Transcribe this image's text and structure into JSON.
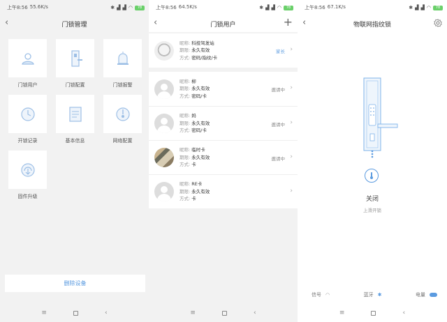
{
  "status": {
    "p1": {
      "time": "上午8:56",
      "speed": "55.6K/s",
      "battery": "78"
    },
    "p2": {
      "time": "上午8:56",
      "speed": "64.5K/s",
      "battery": "78"
    },
    "p3": {
      "time": "上午8:56",
      "speed": "67.1K/s",
      "battery": "78"
    }
  },
  "lock_management": {
    "title": "门锁管理",
    "tiles": [
      {
        "label": "门锁用户",
        "icon": "user-icon"
      },
      {
        "label": "门锁配置",
        "icon": "lock-config-icon"
      },
      {
        "label": "门锁报警",
        "icon": "alarm-icon"
      },
      {
        "label": "开锁记录",
        "icon": "clock-icon"
      },
      {
        "label": "基本信息",
        "icon": "document-icon"
      },
      {
        "label": "网络配置",
        "icon": "network-icon"
      },
      {
        "label": "固件升级",
        "icon": "upgrade-icon"
      }
    ],
    "delete_label": "删除设备"
  },
  "lock_users": {
    "title": "门锁用户",
    "add_icon": "plus-icon",
    "label_nick": "昵称:",
    "label_period": "期限:",
    "label_method": "方式:",
    "users": [
      {
        "nick": "科技驾发站",
        "period": "永久有效",
        "method": "密码/指纹/卡",
        "tag": "家长",
        "tag_kind": "owner"
      },
      {
        "nick": "柳",
        "period": "永久有效",
        "method": "密码/卡",
        "tag": "邀请中",
        "tag_kind": "pending"
      },
      {
        "nick": "妈",
        "period": "永久有效",
        "method": "密码/卡",
        "tag": "邀请中",
        "tag_kind": "pending"
      },
      {
        "nick": "临时卡",
        "period": "永久有效",
        "method": "卡",
        "tag": "邀请中",
        "tag_kind": "pending"
      },
      {
        "nick": "RE卡",
        "period": "永久有效",
        "method": "卡",
        "tag": "",
        "tag_kind": "none"
      }
    ]
  },
  "lock_detail": {
    "title": "物联网指纹锁",
    "status": "关闭",
    "sub_status": "上滑开锁",
    "stats": [
      {
        "label": "信号",
        "icon": "wifi-icon"
      },
      {
        "label": "蓝牙",
        "icon": "bluetooth-icon"
      },
      {
        "label": "电量",
        "icon": "battery-icon"
      }
    ]
  },
  "colors": {
    "accent": "#5b9be0",
    "bg": "#f2f2f2"
  }
}
